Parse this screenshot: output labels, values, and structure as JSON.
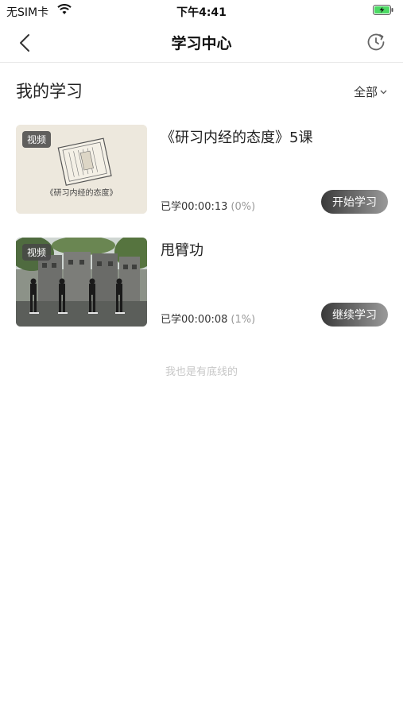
{
  "status_bar": {
    "carrier": "无SIM卡",
    "time": "下午4:41"
  },
  "nav": {
    "title": "学习中心",
    "back_icon": "chevron-left-icon",
    "history_icon": "refresh-history-icon"
  },
  "section": {
    "title": "我的学习",
    "filter_label": "全部"
  },
  "courses": [
    {
      "tag": "视频",
      "thumb_text": "《研习内经的态度》",
      "title": "《研习内经的态度》5课",
      "progress_label": "已学00:00:13",
      "progress_pct": "(0%)",
      "action": "开始学习"
    },
    {
      "tag": "视频",
      "title": "甩臂功",
      "progress_label": "已学00:00:08",
      "progress_pct": "(1%)",
      "action": "继续学习"
    }
  ],
  "footer_note": "我也是有底线的",
  "colors": {
    "button_start": "#3a3a3a",
    "button_end": "#9a9a9a",
    "battery_fill": "#4cd964"
  }
}
